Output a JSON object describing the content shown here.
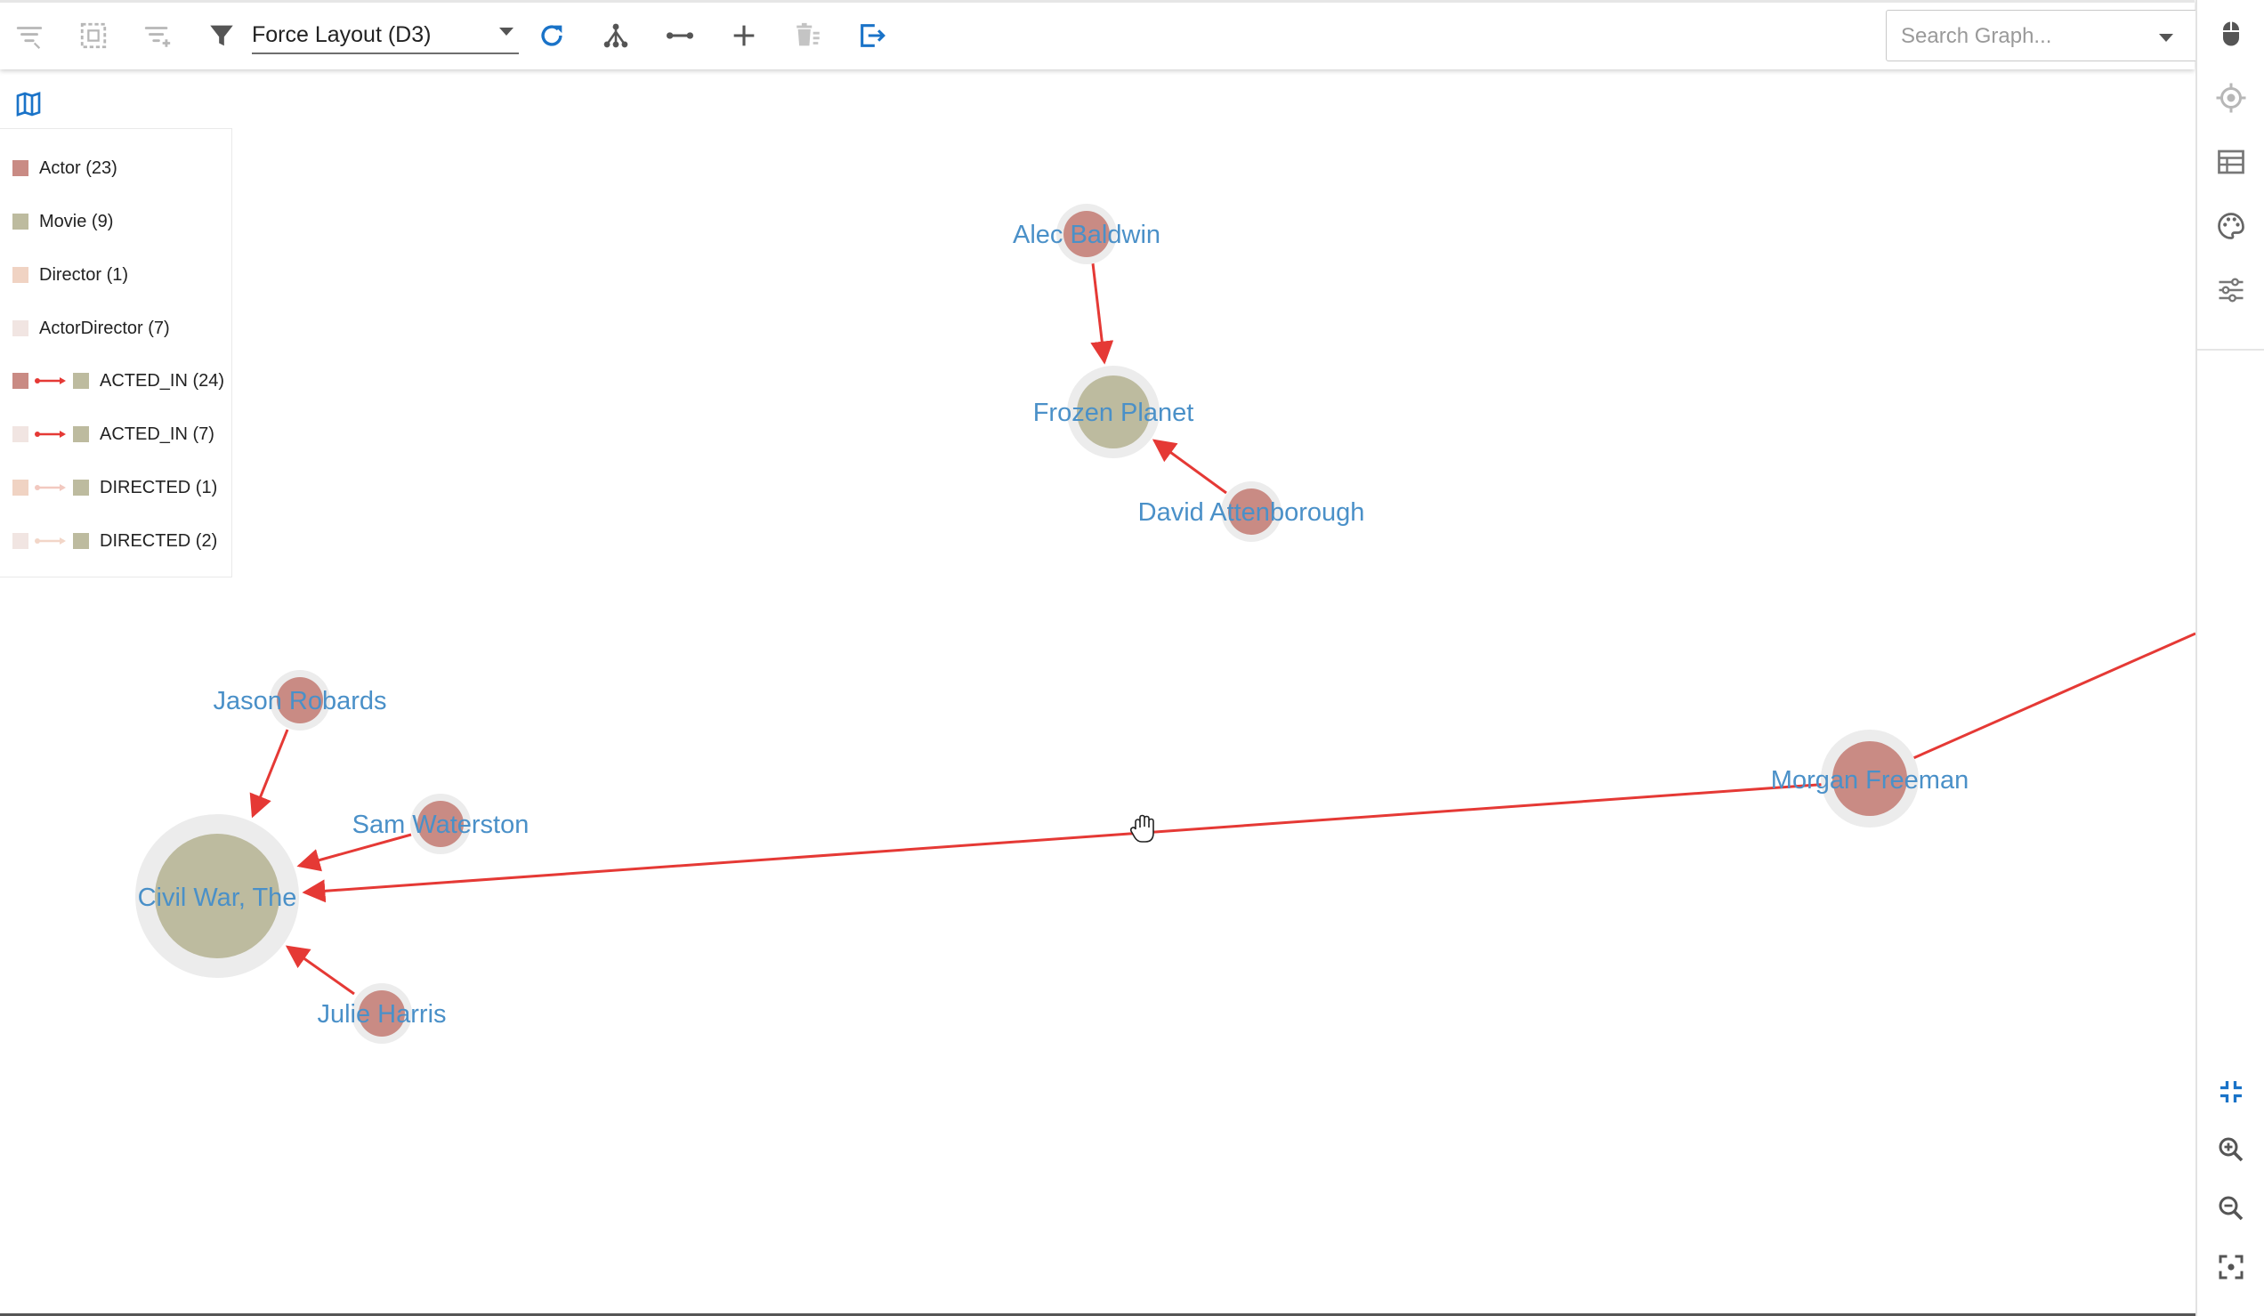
{
  "toolbar": {
    "layout_label": "Force Layout (D3)",
    "search_placeholder": "Search Graph...",
    "accent_color": "#1a73c8",
    "icons": [
      "filter-list-icon",
      "select-box-icon",
      "filter-add-icon",
      "funnel-icon",
      "refresh-icon",
      "hierarchy-icon",
      "expand-horizontal-icon",
      "add-icon",
      "delete-icon",
      "export-icon"
    ]
  },
  "legend": {
    "nodes": [
      {
        "label": "Actor (23)",
        "color": "#c98b84"
      },
      {
        "label": "Movie (9)",
        "color": "#bdbb9f"
      },
      {
        "label": "Director (1)",
        "color": "#f0d3c3"
      },
      {
        "label": "ActorDirector (7)",
        "color": "#f1e5e2"
      }
    ],
    "edges": [
      {
        "label": "ACTED_IN (24)",
        "from_color": "#c98b84",
        "edge_color": "#e53935",
        "to_color": "#bdbb9f"
      },
      {
        "label": "ACTED_IN (7)",
        "from_color": "#f1e5e2",
        "edge_color": "#e53935",
        "to_color": "#bdbb9f"
      },
      {
        "label": "DIRECTED (1)",
        "from_color": "#f0d3c3",
        "edge_color": "#f2c9c0",
        "to_color": "#bdbb9f"
      },
      {
        "label": "DIRECTED (2)",
        "from_color": "#f1e5e2",
        "edge_color": "#f2c9c0",
        "to_color": "#bdbb9f"
      }
    ]
  },
  "graph": {
    "nodes": [
      {
        "id": "alec",
        "label": "Alec Baldwin",
        "type": "Actor"
      },
      {
        "id": "frozen",
        "label": "Frozen Planet",
        "type": "Movie"
      },
      {
        "id": "david",
        "label": "David Attenborough",
        "type": "Actor"
      },
      {
        "id": "jason",
        "label": "Jason Robards",
        "type": "Actor"
      },
      {
        "id": "sam",
        "label": "Sam Waterston",
        "type": "Actor"
      },
      {
        "id": "civil",
        "label": "Civil War, The",
        "type": "Movie"
      },
      {
        "id": "julie",
        "label": "Julie Harris",
        "type": "Actor"
      },
      {
        "id": "morgan",
        "label": "Morgan Freeman",
        "type": "Actor"
      }
    ],
    "edges": [
      {
        "from": "alec",
        "to": "frozen",
        "type": "ACTED_IN"
      },
      {
        "from": "david",
        "to": "frozen",
        "type": "ACTED_IN"
      },
      {
        "from": "jason",
        "to": "civil",
        "type": "ACTED_IN"
      },
      {
        "from": "sam",
        "to": "civil",
        "type": "ACTED_IN"
      },
      {
        "from": "julie",
        "to": "civil",
        "type": "ACTED_IN"
      },
      {
        "from": "morgan",
        "to": "civil",
        "type": "ACTED_IN"
      }
    ],
    "colors": {
      "actor": "#c98b84",
      "movie": "#bdbb9f",
      "halo": "#ececec",
      "edge": "#e53935",
      "label": "#4a90c8"
    }
  },
  "right_rail": {
    "icons": [
      "mouse-icon",
      "target-icon",
      "table-icon",
      "palette-icon",
      "sliders-icon",
      "fit-to-screen-icon",
      "zoom-in-icon",
      "zoom-out-icon",
      "center-focus-icon"
    ]
  }
}
